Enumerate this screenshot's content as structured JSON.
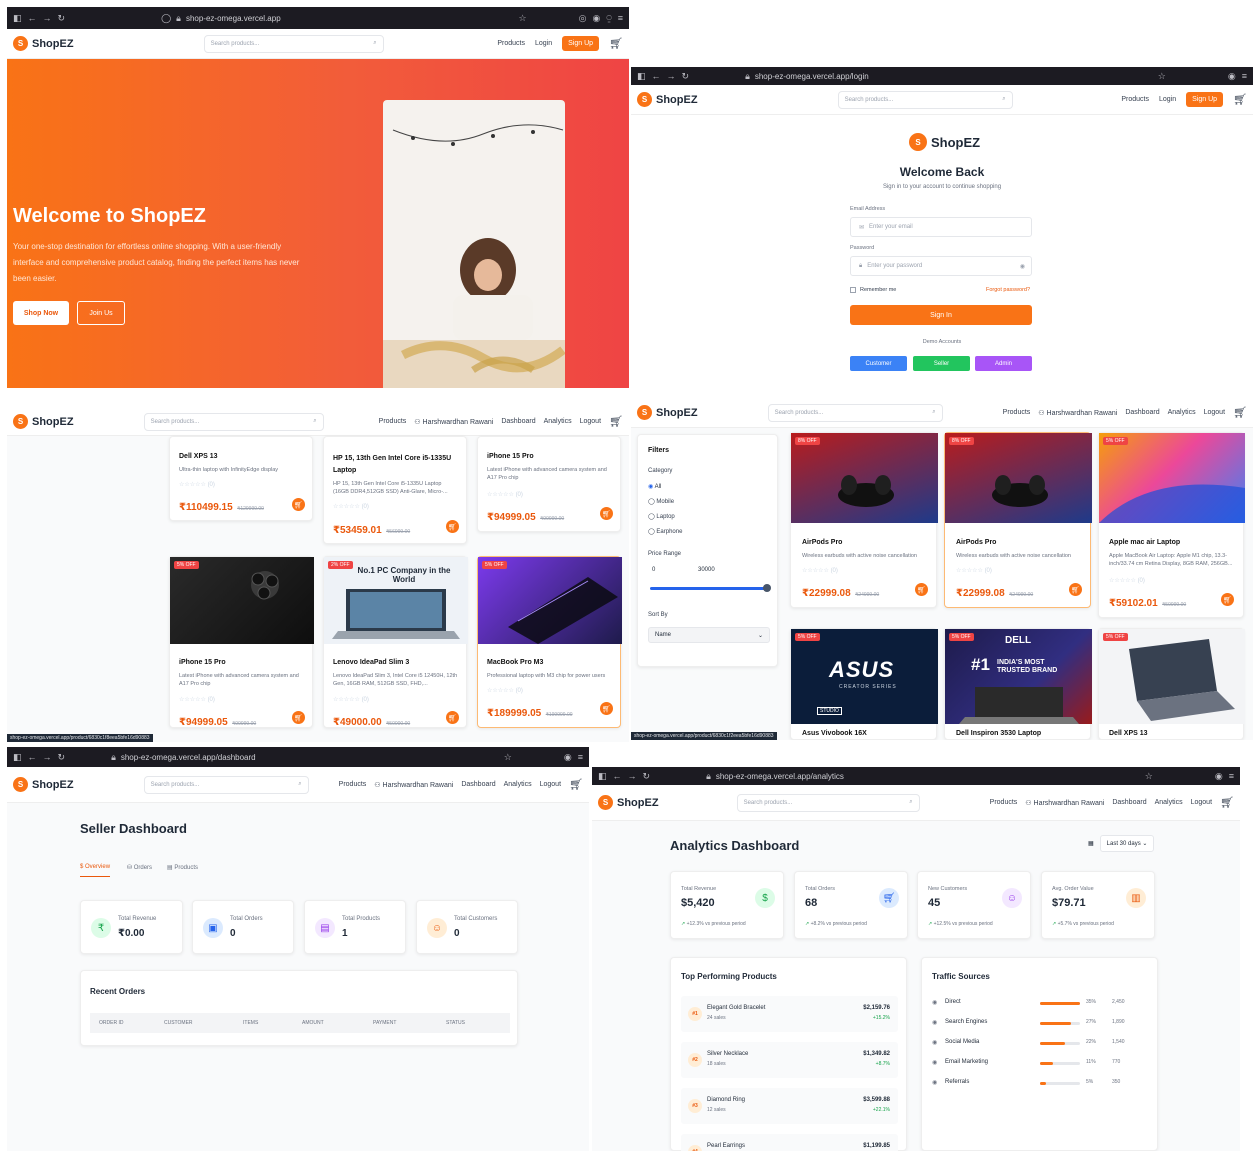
{
  "brand": {
    "logo_letter": "S",
    "name": "ShopEZ",
    "accent": "#f97316"
  },
  "nav": {
    "products": "Products",
    "login": "Login",
    "signup": "Sign Up",
    "user": "Harshwardhan Rawani",
    "dashboard": "Dashboard",
    "analytics": "Analytics",
    "logout": "Logout",
    "search_placeholder": "Search products..."
  },
  "urls": {
    "home": "shop-ez-omega.vercel.app",
    "login": "shop-ez-omega.vercel.app/login",
    "dashboard": "shop-ez-omega.vercel.app/dashboard",
    "analytics": "shop-ez-omega.vercel.app/analytics"
  },
  "hero": {
    "title": "Welcome to ShopEZ",
    "text": "Your one-stop destination for effortless online shopping. With a user-friendly interface and comprehensive product catalog, finding the perfect items has never been easier.",
    "shop_now": "Shop Now",
    "join_us": "Join Us"
  },
  "login": {
    "title": "Welcome Back",
    "subtitle": "Sign in to your account to continue shopping",
    "email_label": "Email Address",
    "email_placeholder": "Enter your email",
    "password_label": "Password",
    "password_placeholder": "Enter your password",
    "remember": "Remember me",
    "forgot": "Forgot password?",
    "signin": "Sign In",
    "demo": "Demo Accounts",
    "customer": "Customer",
    "seller": "Seller",
    "admin": "Admin"
  },
  "products1": [
    {
      "name": "Dell XPS 13",
      "desc": "Ultra-thin laptop with InfinityEdge display",
      "rating": "(0)",
      "price": "₹110499.15",
      "old": "₹129999.00"
    },
    {
      "name": "HP 15, 13th Gen Intel Core i5-1335U Laptop",
      "desc": "HP 15, 13th Gen Intel Core i5-1335U Laptop (16GB DDR4,512GB SSD) Anti-Glare, Micro-...",
      "rating": "(0)",
      "price": "₹53459.01",
      "old": "₹56999.00"
    },
    {
      "name": "iPhone 15 Pro",
      "desc": "Latest iPhone with advanced camera system and A17 Pro chip",
      "rating": "(0)",
      "price": "₹94999.05",
      "old": "₹99999.00"
    },
    {
      "name": "iPhone 15 Pro",
      "desc": "Latest iPhone with advanced camera system and A17 Pro chip",
      "rating": "(0)",
      "price": "₹94999.05",
      "old": "₹99999.00",
      "badge": "5% OFF"
    },
    {
      "name": "Lenovo IdeaPad Slim 3",
      "desc": "Lenovo IdeaPad Slim 3, Intel Core i5 12450H, 12th Gen, 16GB RAM, 512GB SSD, FHD,...",
      "rating": "(0)",
      "price": "₹49000.00",
      "old": "₹50000.00",
      "badge": "2% OFF",
      "banner": "No.1 PC Company in the World"
    },
    {
      "name": "MacBook Pro M3",
      "desc": "Professional laptop with M3 chip for power users",
      "rating": "(0)",
      "price": "₹189999.05",
      "old": "₹199999.00",
      "badge": "5% OFF"
    }
  ],
  "status_url1": "shop-ez-omega.vercel.app/product/6830c1f8eea5bfe16d90883",
  "status_url2": "shop-ez-omega.vercel.app/product/6830c1f2eea5bfe16d90883",
  "filters": {
    "title": "Filters",
    "category": "Category",
    "options": [
      "All",
      "Mobile",
      "Laptop",
      "Earphone"
    ],
    "price_range": "Price Range",
    "min": "0",
    "max": "30000",
    "sort_by": "Sort By",
    "sort_value": "Name"
  },
  "products2": [
    {
      "name": "AirPods Pro",
      "desc": "Wireless earbuds with active noise cancellation",
      "rating": "(0)",
      "price": "₹22999.08",
      "old": "₹24999.00",
      "badge": "8% OFF"
    },
    {
      "name": "AirPods Pro",
      "desc": "Wireless earbuds with active noise cancellation",
      "rating": "(0)",
      "price": "₹22999.08",
      "old": "₹24999.00",
      "badge": "8% OFF"
    },
    {
      "name": "Apple mac air Laptop",
      "desc": "Apple MacBook Air Laptop: Apple M1 chip, 13.3-inch/33.74 cm Retina Display, 8GB RAM, 256GB...",
      "rating": "(0)",
      "price": "₹59102.01",
      "old": "₹59999.00",
      "badge": "5% OFF"
    },
    {
      "name": "Asus Vivobook 16X",
      "badge": "5% OFF",
      "brand": "ASUS",
      "sub": "CREATOR SERIES",
      "tag": "STUDIO"
    },
    {
      "name": "Dell Inspiron 3530 Laptop",
      "badge": "5% OFF",
      "brand": "DELL",
      "tagline": "INDIA'S MOST TRUSTED BRAND",
      "rank": "#1"
    },
    {
      "name": "Dell XPS 13",
      "badge": "5% OFF"
    }
  ],
  "seller": {
    "title": "Seller Dashboard",
    "tabs": [
      "Overview",
      "Orders",
      "Products"
    ],
    "stats": [
      {
        "label": "Total Revenue",
        "value": "₹0.00",
        "icon": "₹"
      },
      {
        "label": "Total Orders",
        "value": "0",
        "icon": "▣"
      },
      {
        "label": "Total Products",
        "value": "1",
        "icon": "▤"
      },
      {
        "label": "Total Customers",
        "value": "0",
        "icon": "☺"
      }
    ],
    "recent": "Recent Orders",
    "cols": [
      "ORDER ID",
      "CUSTOMER",
      "ITEMS",
      "AMOUNT",
      "PAYMENT",
      "STATUS"
    ]
  },
  "analytics": {
    "title": "Analytics Dashboard",
    "range": "Last 30 days",
    "stats": [
      {
        "label": "Total Revenue",
        "value": "$5,420",
        "change": "+12.3% vs previous period",
        "icon": "$",
        "bg": "#dcfce7",
        "fg": "#16a34a"
      },
      {
        "label": "Total Orders",
        "value": "68",
        "change": "+8.2% vs previous period",
        "icon": "🛒",
        "bg": "#dbeafe",
        "fg": "#2563eb"
      },
      {
        "label": "New Customers",
        "value": "45",
        "change": "+12.5% vs previous period",
        "icon": "☺",
        "bg": "#f3e8ff",
        "fg": "#9333ea"
      },
      {
        "label": "Avg. Order Value",
        "value": "$79.71",
        "change": "+5.7% vs previous period",
        "icon": "▥",
        "bg": "#ffedd5",
        "fg": "#ea580c"
      }
    ],
    "top_title": "Top Performing Products",
    "top": [
      {
        "rank": "#1",
        "name": "Elegant Gold Bracelet",
        "sales": "24 sales",
        "amount": "$2,159.76",
        "change": "+15.2%"
      },
      {
        "rank": "#2",
        "name": "Silver Necklace",
        "sales": "18 sales",
        "amount": "$1,349.82",
        "change": "+8.7%"
      },
      {
        "rank": "#3",
        "name": "Diamond Ring",
        "sales": "12 sales",
        "amount": "$3,599.88",
        "change": "+22.1%"
      },
      {
        "rank": "#4",
        "name": "Pearl Earrings",
        "sales": "",
        "amount": "$1,199.85",
        "change": ""
      }
    ],
    "traffic_title": "Traffic Sources",
    "traffic": [
      {
        "name": "Direct",
        "pct": "35%",
        "n": "2,450",
        "v": 35
      },
      {
        "name": "Search Engines",
        "pct": "27%",
        "n": "1,890",
        "v": 27
      },
      {
        "name": "Social Media",
        "pct": "22%",
        "n": "1,540",
        "v": 22
      },
      {
        "name": "Email Marketing",
        "pct": "11%",
        "n": "770",
        "v": 11
      },
      {
        "name": "Referrals",
        "pct": "5%",
        "n": "350",
        "v": 5
      }
    ]
  }
}
